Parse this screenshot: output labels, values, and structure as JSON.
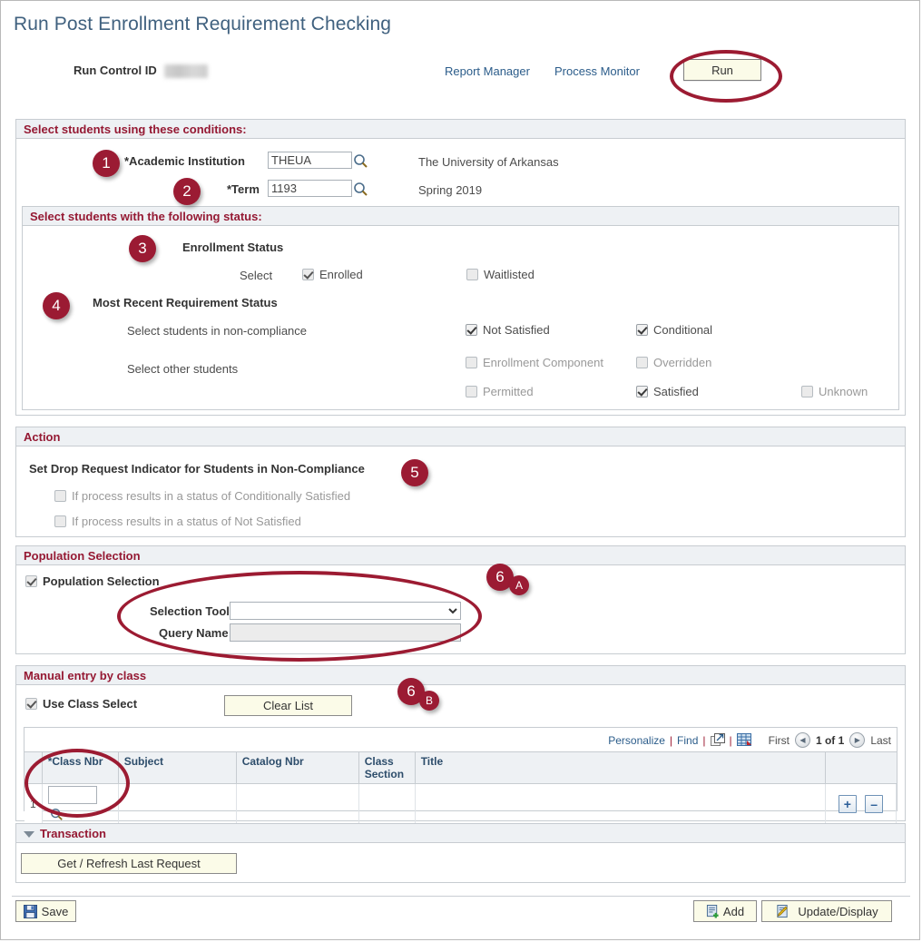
{
  "page": {
    "title": "Run Post Enrollment Requirement Checking",
    "run_control_label": "Run Control ID",
    "run_control_value": ""
  },
  "header": {
    "report_manager": "Report Manager",
    "process_monitor": "Process Monitor",
    "run_button": "Run"
  },
  "conditions": {
    "header": "Select students using these conditions:",
    "institution_label": "*Academic Institution",
    "institution_value": "THEUA",
    "institution_desc": "The University of Arkansas",
    "term_label": "*Term",
    "term_value": "1193",
    "term_desc": "Spring 2019",
    "status_group": {
      "header": "Select students with the following status:",
      "enrollment_status_label": "Enrollment Status",
      "select_label": "Select",
      "enrolled": {
        "label": "Enrolled",
        "checked": true
      },
      "waitlisted": {
        "label": "Waitlisted",
        "checked": false
      },
      "requirement_status_label": "Most Recent Requirement Status",
      "noncompliance_label": "Select students in non-compliance",
      "other_label": "Select other students",
      "not_satisfied": {
        "label": "Not Satisfied",
        "checked": true
      },
      "conditional": {
        "label": "Conditional",
        "checked": true
      },
      "enrollment_component": {
        "label": "Enrollment Component",
        "checked": false
      },
      "overridden": {
        "label": "Overridden",
        "checked": false
      },
      "permitted": {
        "label": "Permitted",
        "checked": false
      },
      "satisfied": {
        "label": "Satisfied",
        "checked": true
      },
      "unknown": {
        "label": "Unknown",
        "checked": false
      }
    }
  },
  "action": {
    "header": "Action",
    "title": "Set Drop Request Indicator for Students in Non-Compliance",
    "opt_conditionally": {
      "label": "If process results in a status of Conditionally Satisfied",
      "checked": false
    },
    "opt_not_satisfied": {
      "label": "If process results in a status of Not Satisfied",
      "checked": false
    }
  },
  "population": {
    "header": "Population Selection",
    "checkbox_label": "Population Selection",
    "checkbox_checked": true,
    "selection_tool_label": "Selection Tool",
    "selection_tool_value": "",
    "query_name_label": "Query Name",
    "query_name_value": ""
  },
  "manual": {
    "header": "Manual entry by class",
    "use_class_select_label": "Use Class Select",
    "use_class_select_checked": true,
    "clear_list_button": "Clear List",
    "grid": {
      "personalize": "Personalize",
      "find": "Find",
      "view_all_icon": "expand-grid-icon",
      "download_icon": "download-grid-icon",
      "first": "First",
      "page_indicator": "1 of 1",
      "last": "Last",
      "columns": [
        "*Class Nbr",
        "Subject",
        "Catalog Nbr",
        "Class Section",
        "Title"
      ],
      "rows": [
        {
          "num": "1",
          "class_nbr": "",
          "subject": "",
          "catalog_nbr": "",
          "class_section": "",
          "title": ""
        }
      ],
      "add_row_button": "+",
      "delete_row_button": "–"
    }
  },
  "transaction": {
    "header": "Transaction",
    "get_refresh_button": "Get / Refresh Last Request"
  },
  "footer": {
    "save_button": "Save",
    "add_button": "Add",
    "update_display_button": "Update/Display"
  },
  "annotations": {
    "b1": "1",
    "b2": "2",
    "b3": "3",
    "b4": "4",
    "b5": "5",
    "b6a_main": "6",
    "b6a_sub": "A",
    "b6b_main": "6",
    "b6b_sub": "B"
  },
  "colors": {
    "accent_maroon": "#9b1b33",
    "title_blue": "#40617f",
    "link_blue": "#2b5c8a",
    "header_bg": "#eef1f4",
    "button_bg": "#fbfbe8"
  }
}
